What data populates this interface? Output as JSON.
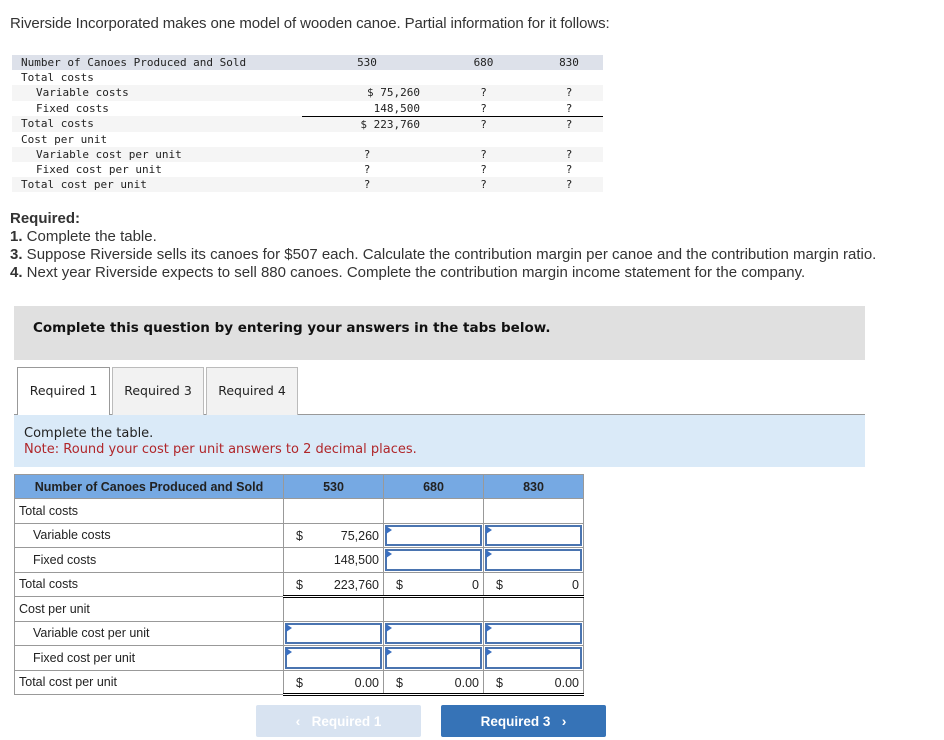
{
  "intro": "Riverside Incorporated makes one model of wooden canoe. Partial information for it follows:",
  "info_table": {
    "header": {
      "label": "Number of Canoes Produced and Sold",
      "cols": [
        "530",
        "680",
        "830"
      ]
    },
    "rows": [
      {
        "label": "Total costs",
        "vals": [
          "",
          "",
          ""
        ]
      },
      {
        "label": "Variable costs",
        "vals": [
          "$ 75,260",
          "?",
          "?"
        ]
      },
      {
        "label": "Fixed costs",
        "vals": [
          "148,500",
          "?",
          "?"
        ]
      },
      {
        "label": "Total costs",
        "vals": [
          "$ 223,760",
          "?",
          "?"
        ]
      },
      {
        "label": "Cost per unit",
        "vals": [
          "",
          "",
          ""
        ]
      },
      {
        "label": "Variable cost per unit",
        "vals": [
          "?",
          "?",
          "?"
        ]
      },
      {
        "label": "Fixed cost per unit",
        "vals": [
          "?",
          "?",
          "?"
        ]
      },
      {
        "label": "Total cost per unit",
        "vals": [
          "?",
          "?",
          "?"
        ]
      }
    ]
  },
  "required": {
    "heading": "Required:",
    "items": [
      {
        "num": "1.",
        "text": " Complete the table."
      },
      {
        "num": "3.",
        "text": " Suppose Riverside sells its canoes for $507 each. Calculate the contribution margin per canoe and the contribution margin ratio."
      },
      {
        "num": "4.",
        "text": " Next year Riverside expects to sell 880 canoes. Complete the contribution margin income statement for the company."
      }
    ]
  },
  "instruction": "Complete this question by entering your answers in the tabs below.",
  "tabs": [
    {
      "label": "Required 1",
      "active": true
    },
    {
      "label": "Required 3",
      "active": false
    },
    {
      "label": "Required 4",
      "active": false
    }
  ],
  "note": {
    "line1": "Complete the table.",
    "line2": "Note: Round your cost per unit answers to 2 decimal places."
  },
  "answer_table": {
    "header": {
      "label": "Number of Canoes Produced and Sold",
      "cols": [
        "530",
        "680",
        "830"
      ]
    },
    "rows": {
      "total_costs_hdr": "Total costs",
      "variable_costs": {
        "label": "Variable costs",
        "c530": {
          "dollar": "$",
          "value": "75,260"
        },
        "c680": "",
        "c830": ""
      },
      "fixed_costs": {
        "label": "Fixed costs",
        "c530": {
          "value": "148,500"
        },
        "c680": "",
        "c830": ""
      },
      "total_costs": {
        "label": "Total costs",
        "c530": {
          "dollar": "$",
          "value": "223,760"
        },
        "c680": {
          "dollar": "$",
          "value": "0"
        },
        "c830": {
          "dollar": "$",
          "value": "0"
        }
      },
      "cost_per_unit_hdr": "Cost per unit",
      "variable_cpu": {
        "label": "Variable cost per unit",
        "c530": "",
        "c680": "",
        "c830": ""
      },
      "fixed_cpu": {
        "label": "Fixed cost per unit",
        "c530": "",
        "c680": "",
        "c830": ""
      },
      "total_cpu": {
        "label": "Total cost per unit",
        "c530": {
          "dollar": "$",
          "value": "0.00"
        },
        "c680": {
          "dollar": "$",
          "value": "0.00"
        },
        "c830": {
          "dollar": "$",
          "value": "0.00"
        }
      }
    }
  },
  "nav": {
    "prev_label": "Required 1",
    "next_label": "Required 3",
    "prev_icon": "‹",
    "next_icon": "›"
  }
}
